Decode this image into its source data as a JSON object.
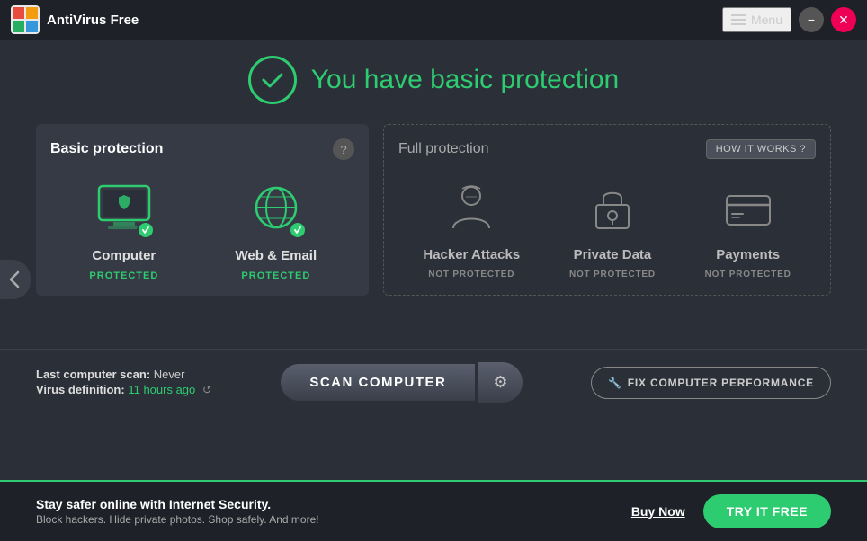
{
  "titlebar": {
    "app_name": "AntiVirus Free",
    "menu_label": "Menu",
    "min_label": "−",
    "close_label": "✕"
  },
  "status": {
    "title": "You have basic protection"
  },
  "basic_protection": {
    "title": "Basic protection",
    "help_label": "?",
    "computer": {
      "label": "Computer",
      "status": "PROTECTED"
    },
    "web_email": {
      "label": "Web & Email",
      "status": "PROTECTED"
    }
  },
  "full_protection": {
    "title": "Full protection",
    "how_it_works": "HOW IT WORKS ?",
    "hacker": {
      "label": "Hacker Attacks",
      "status": "NOT PROTECTED"
    },
    "private_data": {
      "label": "Private Data",
      "status": "NOT PROTECTED"
    },
    "payments": {
      "label": "Payments",
      "status": "NOT PROTECTED"
    }
  },
  "scan_bar": {
    "last_scan_label": "Last computer scan:",
    "last_scan_value": "Never",
    "virus_def_label": "Virus definition:",
    "virus_def_value": "11 hours ago",
    "scan_button": "SCAN COMPUTER",
    "fix_button": "FIX COMPUTER PERFORMANCE"
  },
  "promo": {
    "title": "Stay safer online with Internet Security.",
    "subtitle": "Block hackers. Hide private photos. Shop safely. And more!",
    "buy_now": "Buy Now",
    "try_free": "TRY IT FREE"
  }
}
